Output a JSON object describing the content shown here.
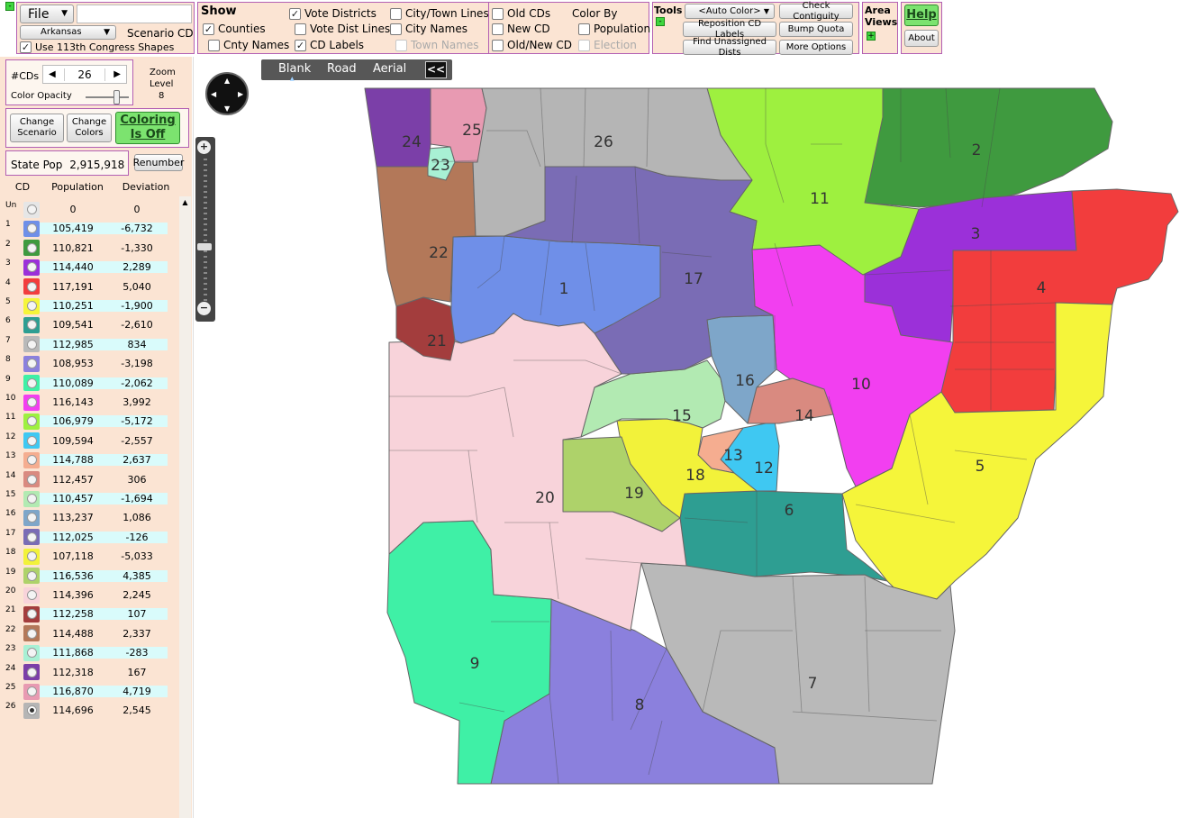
{
  "toolbar": {
    "file_label": "File",
    "state_select": "Arkansas",
    "scenario_label": "Scenario CD",
    "use_shapes_label": "Use 113th Congress Shapes",
    "show_title": "Show",
    "show_options": {
      "counties": "Counties",
      "cnty_names": "Cnty Names",
      "vote_districts": "Vote Districts",
      "vote_dist_lines": "Vote Dist Lines",
      "cd_labels": "CD Labels",
      "city_town_lines": "City/Town Lines",
      "city_names": "City Names",
      "town_names": "Town Names",
      "old_cds": "Old CDs",
      "new_cd": "New CD",
      "old_new_cd": "Old/New CD"
    },
    "color_by_title": "Color By",
    "color_by_population": "Population",
    "color_by_election": "Election",
    "tools_title": "Tools",
    "auto_color": "<Auto Color>",
    "reposition_labels": "Reposition CD Labels",
    "find_unassigned": "Find Unassigned Dists",
    "check_contiguity": "Check Contiguity",
    "bump_quota": "Bump Quota",
    "more_options": "More Options",
    "area_views_line1": "Area",
    "area_views_line2": "Views",
    "help": "Help",
    "about": "About"
  },
  "left": {
    "num_cds_label": "#CDs",
    "num_cds_value": "26",
    "zoom_level_line1": "Zoom",
    "zoom_level_line2": "Level",
    "zoom_level_value": "8",
    "color_opacity_label": "Color Opacity",
    "color_opacity_value": 0.85,
    "change_scenario_line1": "Change",
    "change_scenario_line2": "Scenario",
    "change_colors_line1": "Change",
    "change_colors_line2": "Colors",
    "coloring_line1": "Coloring",
    "coloring_line2": "Is Off",
    "state_pop_label": "State Pop",
    "state_pop_value": "2,915,918",
    "renumber": "Renumber"
  },
  "table": {
    "headers": [
      "CD",
      "Population",
      "Deviation"
    ],
    "rows": [
      {
        "cd": "Un",
        "population": "0",
        "deviation": "0",
        "color": "#e6e6e6"
      },
      {
        "cd": "1",
        "population": "105,419",
        "deviation": "-6,732",
        "color": "#6f8fe8"
      },
      {
        "cd": "2",
        "population": "110,821",
        "deviation": "-1,330",
        "color": "#3f9a3f"
      },
      {
        "cd": "3",
        "population": "114,440",
        "deviation": "2,289",
        "color": "#9b30d9"
      },
      {
        "cd": "4",
        "population": "117,191",
        "deviation": "5,040",
        "color": "#f23d3d"
      },
      {
        "cd": "5",
        "population": "110,251",
        "deviation": "-1,900",
        "color": "#f5f53a"
      },
      {
        "cd": "6",
        "population": "109,541",
        "deviation": "-2,610",
        "color": "#2e9e92"
      },
      {
        "cd": "7",
        "population": "112,985",
        "deviation": "834",
        "color": "#b9b9b9"
      },
      {
        "cd": "8",
        "population": "108,953",
        "deviation": "-3,198",
        "color": "#8b80dd"
      },
      {
        "cd": "9",
        "population": "110,089",
        "deviation": "-2,062",
        "color": "#3ff0a6"
      },
      {
        "cd": "10",
        "population": "116,143",
        "deviation": "3,992",
        "color": "#f23ff0"
      },
      {
        "cd": "11",
        "population": "106,979",
        "deviation": "-5,172",
        "color": "#9ef03f"
      },
      {
        "cd": "12",
        "population": "109,594",
        "deviation": "-2,557",
        "color": "#3fc8f2"
      },
      {
        "cd": "13",
        "population": "114,788",
        "deviation": "2,637",
        "color": "#f5ad90"
      },
      {
        "cd": "14",
        "population": "112,457",
        "deviation": "306",
        "color": "#d98a80"
      },
      {
        "cd": "15",
        "population": "110,457",
        "deviation": "-1,694",
        "color": "#b2eab2"
      },
      {
        "cd": "16",
        "population": "113,237",
        "deviation": "1,086",
        "color": "#7ea6c9"
      },
      {
        "cd": "17",
        "population": "112,025",
        "deviation": "-126",
        "color": "#7a6cb5"
      },
      {
        "cd": "18",
        "population": "107,118",
        "deviation": "-5,033",
        "color": "#f2f23a"
      },
      {
        "cd": "19",
        "population": "116,536",
        "deviation": "4,385",
        "color": "#aed26a"
      },
      {
        "cd": "20",
        "population": "114,396",
        "deviation": "2,245",
        "color": "#f8d3da"
      },
      {
        "cd": "21",
        "population": "112,258",
        "deviation": "107",
        "color": "#a33d3d"
      },
      {
        "cd": "22",
        "population": "114,488",
        "deviation": "2,337",
        "color": "#b37859"
      },
      {
        "cd": "23",
        "population": "111,868",
        "deviation": "-283",
        "color": "#a8f0d4"
      },
      {
        "cd": "24",
        "population": "112,318",
        "deviation": "167",
        "color": "#7b3fa8"
      },
      {
        "cd": "25",
        "population": "116,870",
        "deviation": "4,719",
        "color": "#e89ab2"
      },
      {
        "cd": "26",
        "population": "114,696",
        "deviation": "2,545",
        "color": "#b5b5b5"
      }
    ]
  },
  "map_tabs": [
    "Blank",
    "Road",
    "Aerial"
  ],
  "map_collapse": "<<",
  "districts": [
    {
      "label": "1",
      "color": "#6f8fe8"
    },
    {
      "label": "2",
      "color": "#3f9a3f"
    },
    {
      "label": "3",
      "color": "#9b30d9"
    },
    {
      "label": "4",
      "color": "#f23d3d"
    },
    {
      "label": "5",
      "color": "#f5f53a"
    },
    {
      "label": "6",
      "color": "#2e9e92"
    },
    {
      "label": "7",
      "color": "#b9b9b9"
    },
    {
      "label": "8",
      "color": "#8b80dd"
    },
    {
      "label": "9",
      "color": "#3ff0a6"
    },
    {
      "label": "10",
      "color": "#f23ff0"
    },
    {
      "label": "11",
      "color": "#9ef03f"
    },
    {
      "label": "12",
      "color": "#3fc8f2"
    },
    {
      "label": "13",
      "color": "#f5ad90"
    },
    {
      "label": "14",
      "color": "#d98a80"
    },
    {
      "label": "15",
      "color": "#b2eab2"
    },
    {
      "label": "16",
      "color": "#7ea6c9"
    },
    {
      "label": "17",
      "color": "#7a6cb5"
    },
    {
      "label": "18",
      "color": "#f2f23a"
    },
    {
      "label": "19",
      "color": "#aed26a"
    },
    {
      "label": "20",
      "color": "#f8d3da"
    },
    {
      "label": "21",
      "color": "#a33d3d"
    },
    {
      "label": "22",
      "color": "#b37859"
    },
    {
      "label": "23",
      "color": "#a8f0d4"
    },
    {
      "label": "24",
      "color": "#7b3fa8"
    },
    {
      "label": "25",
      "color": "#e89ab2"
    },
    {
      "label": "26",
      "color": "#b5b5b5"
    }
  ]
}
